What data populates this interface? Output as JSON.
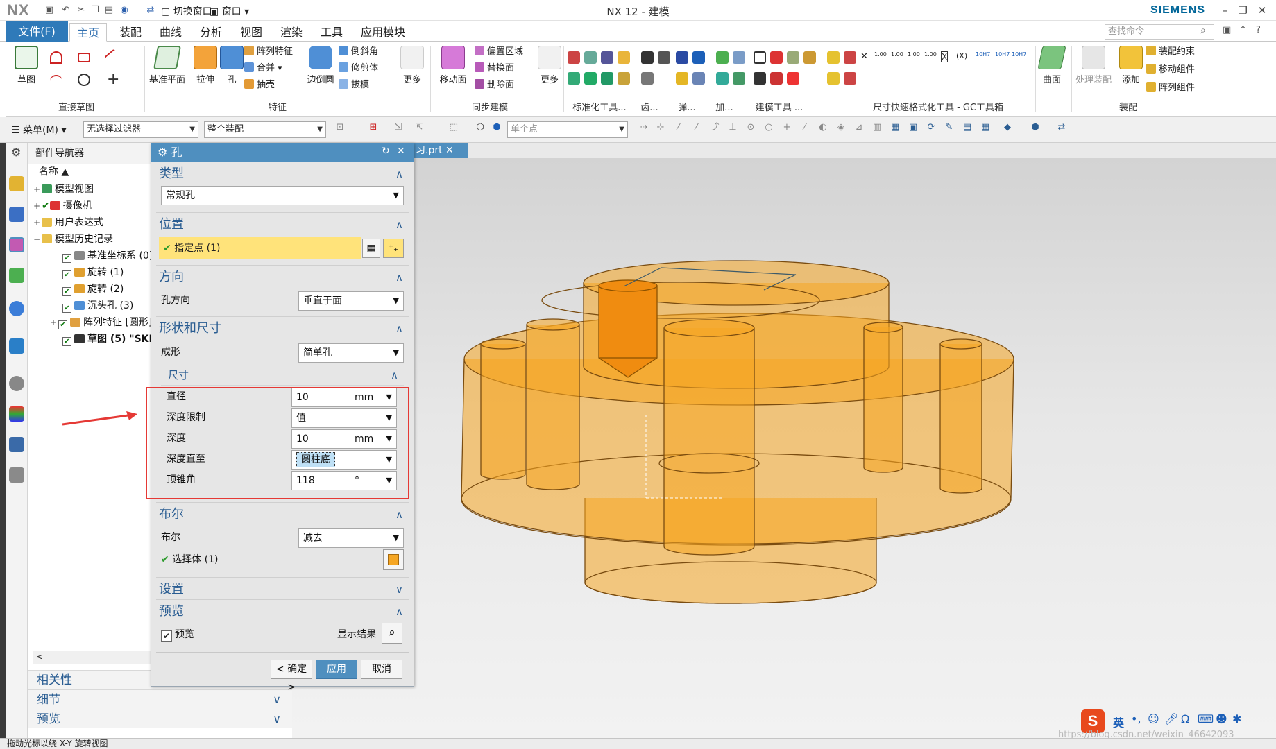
{
  "app": {
    "logo": "NX",
    "title": "NX 12 - 建模",
    "brand": "SIEMENS",
    "switch_window": "切换窗口",
    "window_menu": "窗口"
  },
  "menu": {
    "file": "文件(F)",
    "tabs": [
      "主页",
      "装配",
      "曲线",
      "分析",
      "视图",
      "渲染",
      "工具",
      "应用模块"
    ],
    "search_placeholder": "查找命令"
  },
  "ribbon": {
    "sketch": "草图",
    "direct_sketch": "直接草图",
    "datum_plane": "基准平面",
    "extrude": "拉伸",
    "hole": "孔",
    "pattern_feature": "阵列特征",
    "unite": "合并",
    "shell": "抽壳",
    "edge_blend": "边倒圆",
    "chamfer": "倒斜角",
    "trim_body": "修剪体",
    "draft": "拔模",
    "more": "更多",
    "feature": "特征",
    "move_face": "移动面",
    "offset_region": "偏置区域",
    "replace_face": "替换面",
    "delete_face": "删除面",
    "more2": "更多",
    "sync": "同步建模",
    "std_tools": "标准化工具...",
    "gear": "齿...",
    "spring": "弹...",
    "add": "加...",
    "model_tools": "建模工具 ...",
    "dim_tools": "尺寸快速格式化工具 - GC工具箱",
    "surface": "曲面",
    "process_asm": "处理装配",
    "add2": "添加",
    "asm_constraint": "装配约束",
    "move_comp": "移动组件",
    "pattern_comp": "阵列组件",
    "assembly": "装配"
  },
  "selbar": {
    "menu": "菜单(M)",
    "filter": "无选择过滤器",
    "scope": "整个装配",
    "snap": "单个点"
  },
  "navigator": {
    "title": "部件导航器",
    "col_name": "名称",
    "rows": [
      {
        "label": "模型视图"
      },
      {
        "label": "摄像机"
      },
      {
        "label": "用户表达式"
      },
      {
        "label": "模型历史记录"
      },
      {
        "label": "基准坐标系 (0)"
      },
      {
        "label": "旋转 (1)"
      },
      {
        "label": "旋转 (2)"
      },
      {
        "label": "沉头孔 (3)"
      },
      {
        "label": "阵列特征 [圆形]"
      },
      {
        "label": "草图 (5) \"SKE"
      }
    ],
    "panels": [
      "相关性",
      "细节",
      "预览"
    ]
  },
  "dialog": {
    "title": "孔",
    "type": {
      "header": "类型",
      "value": "常规孔"
    },
    "position": {
      "header": "位置",
      "specify_point": "指定点 (1)"
    },
    "direction": {
      "header": "方向",
      "label": "孔方向",
      "value": "垂直于面"
    },
    "form": {
      "header": "形状和尺寸",
      "label": "成形",
      "value": "简单孔"
    },
    "dims": {
      "header": "尺寸",
      "diameter_label": "直径",
      "diameter": "10",
      "diameter_unit": "mm",
      "depth_limit_label": "深度限制",
      "depth_limit": "值",
      "depth_label": "深度",
      "depth": "10",
      "depth_unit": "mm",
      "depth_to_label": "深度直至",
      "depth_to": "圆柱底",
      "tip_angle_label": "顶锥角",
      "tip_angle": "118",
      "tip_unit": "°"
    },
    "boolean": {
      "header": "布尔",
      "label": "布尔",
      "value": "减去",
      "select_body": "选择体 (1)"
    },
    "settings": {
      "header": "设置"
    },
    "preview": {
      "header": "预览",
      "checkbox": "预览",
      "show_result": "显示结果"
    },
    "buttons": {
      "ok": "< 确定 >",
      "apply": "应用",
      "cancel": "取消"
    }
  },
  "viewport": {
    "tab": "习.prt"
  },
  "status": {
    "text": "拖动光标以绕 X-Y 旋转视图"
  },
  "ime": {
    "lang": "英"
  },
  "watermark": "https://blog.csdn.net/weixin_46642093",
  "colors": {
    "accent": "#2f7ab9",
    "dialog_header": "#4f8fbf",
    "highlight": "#ffe37a",
    "annotation_red": "#e53935",
    "body_orange": "#f5a623"
  }
}
